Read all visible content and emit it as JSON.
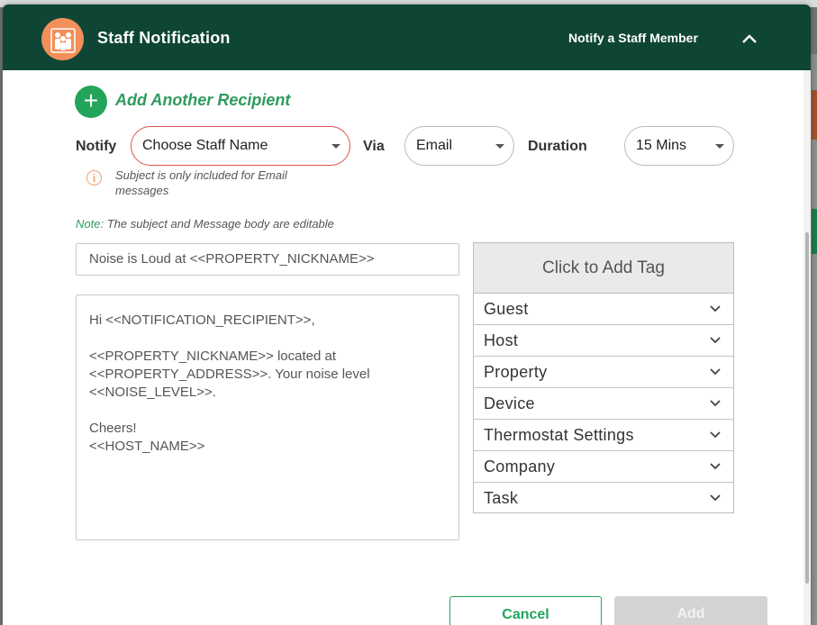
{
  "header": {
    "title": "Staff Notification",
    "subtitle": "Notify a Staff Member",
    "logo_icon": "staff-group-icon",
    "collapse_icon": "chevron-up-icon"
  },
  "add_recipient": {
    "label": "Add Another Recipient",
    "icon": "plus-icon"
  },
  "form": {
    "notify_label": "Notify",
    "staff_select": "Choose Staff Name",
    "via_label": "Via",
    "via_select": "Email",
    "duration_label": "Duration",
    "duration_select": "15 Mins"
  },
  "info": {
    "text": "Subject is only included for Email messages",
    "icon": "info-icon"
  },
  "note": {
    "prefix": "Note:",
    "text": " The subject and Message body are editable"
  },
  "subject": "Noise is Loud at <<PROPERTY_NICKNAME>>",
  "message_lines": [
    "Hi <<NOTIFICATION_RECIPIENT>>,",
    "",
    "<<PROPERTY_NICKNAME>> located at",
    "<<PROPERTY_ADDRESS>>. Your noise level",
    "<<NOISE_LEVEL>>.",
    "",
    "Cheers!",
    "<<HOST_NAME>>"
  ],
  "tags": {
    "header": "Click to Add Tag",
    "items": [
      "Guest",
      "Host",
      "Property",
      "Device",
      "Thermostat Settings",
      "Company",
      "Task"
    ]
  },
  "actions": {
    "cancel": "Cancel",
    "add": "Add"
  },
  "colors": {
    "header_bg": "#0f4535",
    "accent": "#22a55a",
    "logo_bg": "#f28f5a",
    "error": "#d9534f"
  }
}
